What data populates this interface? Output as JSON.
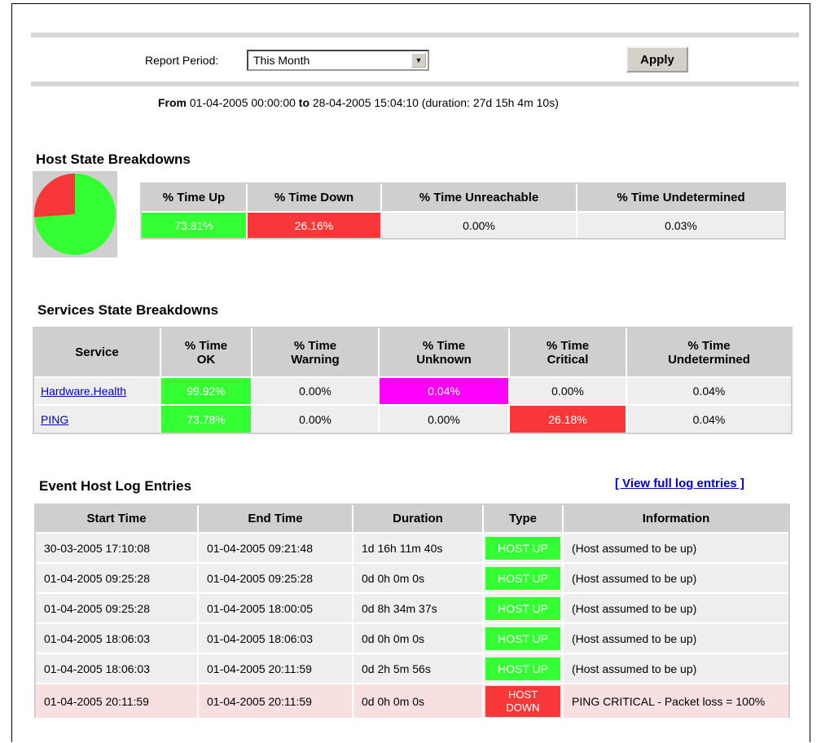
{
  "report": {
    "period_label": "Report Period:",
    "period_value": "This Month",
    "apply_label": "Apply",
    "from_label": "From",
    "from_value": "01-04-2005 00:00:00",
    "to_label": "to",
    "to_value": "28-04-2005 15:04:10",
    "duration_text": "(duration: 27d 15h 4m 10s)"
  },
  "host_state": {
    "title": "Host State Breakdowns",
    "headers": [
      "% Time Up",
      "% Time Down",
      "% Time Unreachable",
      "% Time Undetermined"
    ],
    "values": [
      "73.81%",
      "26.16%",
      "0.00%",
      "0.03%"
    ],
    "pie": {
      "up_fraction": 0.7381,
      "down_fraction": 0.2616,
      "up_color": "#33ff33",
      "down_color": "#f83838"
    }
  },
  "services_state": {
    "title": "Services State Breakdowns",
    "headers": [
      "Service",
      "% Time OK",
      "% Time Warning",
      "% Time Unknown",
      "% Time Critical",
      "% Time Undetermined"
    ],
    "header_lines": [
      [
        "Service"
      ],
      [
        "% Time",
        "OK"
      ],
      [
        "% Time",
        "Warning"
      ],
      [
        "% Time",
        "Unknown"
      ],
      [
        "% Time",
        "Critical"
      ],
      [
        "% Time",
        "Undetermined"
      ]
    ],
    "rows": [
      {
        "service": "Hardware.Health",
        "ok": "99.92%",
        "warning": "0.00%",
        "unknown": "0.04%",
        "critical": "0.00%",
        "undetermined": "0.04%"
      },
      {
        "service": "PING",
        "ok": "73.78%",
        "warning": "0.00%",
        "unknown": "0.00%",
        "critical": "26.18%",
        "undetermined": "0.04%"
      }
    ]
  },
  "event_log": {
    "title": "Event Host Log Entries",
    "view_full_label": "[ View full log entries ]",
    "headers": [
      "Start Time",
      "End Time",
      "Duration",
      "Type",
      "Information"
    ],
    "rows": [
      {
        "start": "30-03-2005 17:10:08",
        "end": "01-04-2005 09:21:48",
        "duration": "1d 16h 11m 40s",
        "type": "HOST UP",
        "info": "(Host assumed to be up)"
      },
      {
        "start": "01-04-2005 09:25:28",
        "end": "01-04-2005 09:25:28",
        "duration": "0d 0h 0m 0s",
        "type": "HOST UP",
        "info": "(Host assumed to be up)"
      },
      {
        "start": "01-04-2005 09:25:28",
        "end": "01-04-2005 18:00:05",
        "duration": "0d 8h 34m 37s",
        "type": "HOST UP",
        "info": "(Host assumed to be up)"
      },
      {
        "start": "01-04-2005 18:06:03",
        "end": "01-04-2005 18:06:03",
        "duration": "0d 0h 0m 0s",
        "type": "HOST UP",
        "info": "(Host assumed to be up)"
      },
      {
        "start": "01-04-2005 18:06:03",
        "end": "01-04-2005 20:11:59",
        "duration": "0d 2h 5m 56s",
        "type": "HOST UP",
        "info": "(Host assumed to be up)"
      },
      {
        "start": "01-04-2005 20:11:59",
        "end": "01-04-2005 20:11:59",
        "duration": "0d 0h 0m 0s",
        "type_lines": [
          "HOST",
          "DOWN"
        ],
        "type": "HOST DOWN",
        "info": "PING CRITICAL - Packet loss = 100%"
      }
    ]
  }
}
